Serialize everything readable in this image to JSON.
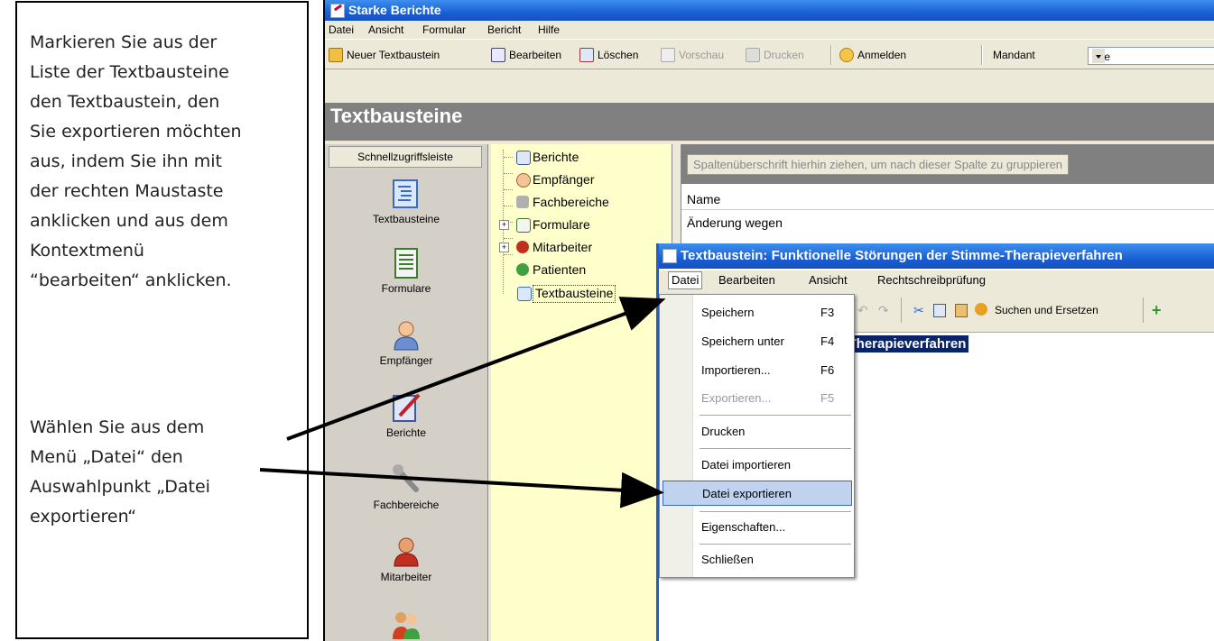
{
  "instructions": {
    "first": [
      "Markieren Sie aus der",
      "Liste der Textbausteine",
      "den Textbaustein,  den",
      "Sie exportieren möchten",
      "aus, indem Sie ihn mit",
      "der rechten Maustaste",
      "anklicken und aus dem",
      "Kontextmenü",
      "“bearbeiten“ anklicken."
    ],
    "second": [
      "Wählen Sie  aus dem",
      "Menü „Datei“ den",
      "Auswahlpunkt „Datei",
      "exportieren“"
    ]
  },
  "app": {
    "title": "Starke Berichte",
    "menu": [
      "Datei",
      "Ansicht",
      "Formular",
      "Bericht",
      "Hilfe"
    ],
    "toolbar": {
      "new": "Neuer Textbaustein",
      "edit": "Bearbeiten",
      "delete": "Löschen",
      "preview": "Vorschau",
      "print": "Drucken",
      "login": "Anmelden",
      "client_label": "Mandant",
      "client_value": "Alle"
    },
    "header": "Textbausteine",
    "sidebar": {
      "header": "Schnellzugriffsleiste",
      "items": [
        "Textbausteine",
        "Formulare",
        "Empfänger",
        "Berichte",
        "Fachbereiche",
        "Mitarbeiter"
      ]
    },
    "tree": [
      "Berichte",
      "Empfänger",
      "Fachbereiche",
      "Formulare",
      "Mitarbeiter",
      "Patienten",
      "Textbausteine"
    ],
    "grid": {
      "group_hint": "Spaltenüberschrift hierhin ziehen, um nach dieser Spalte zu gruppieren",
      "column": "Name",
      "rows": [
        "Änderung wegen"
      ]
    }
  },
  "dialog": {
    "title": "Textbaustein: Funktionelle Störungen der Stimme-Therapieverfahren",
    "menu": [
      "Datei",
      "Bearbeiten",
      "Ansicht",
      "Rechtschreibprüfung"
    ],
    "toolbar": {
      "search_replace": "Suchen und Ersetzen"
    },
    "selected_text": "ne-Therapieverfahren"
  },
  "file_menu": {
    "items": [
      {
        "label": "Speichern",
        "shortcut": "F3"
      },
      {
        "label": "Speichern unter",
        "shortcut": "F4"
      },
      {
        "label": "Importieren...",
        "shortcut": "F6"
      },
      {
        "label": "Exportieren...",
        "shortcut": "F5"
      },
      {
        "label": "Drucken",
        "shortcut": ""
      },
      {
        "label": "Datei importieren",
        "shortcut": ""
      },
      {
        "label": "Datei exportieren",
        "shortcut": ""
      },
      {
        "label": "Eigenschaften...",
        "shortcut": ""
      },
      {
        "label": "Schließen",
        "shortcut": ""
      }
    ]
  },
  "colors": {
    "titlebar": "#1a5fd4",
    "header_gray": "#808080",
    "tree_bg": "#ffffcc",
    "highlight": "#c1d2ee",
    "selection": "#0a246a"
  }
}
